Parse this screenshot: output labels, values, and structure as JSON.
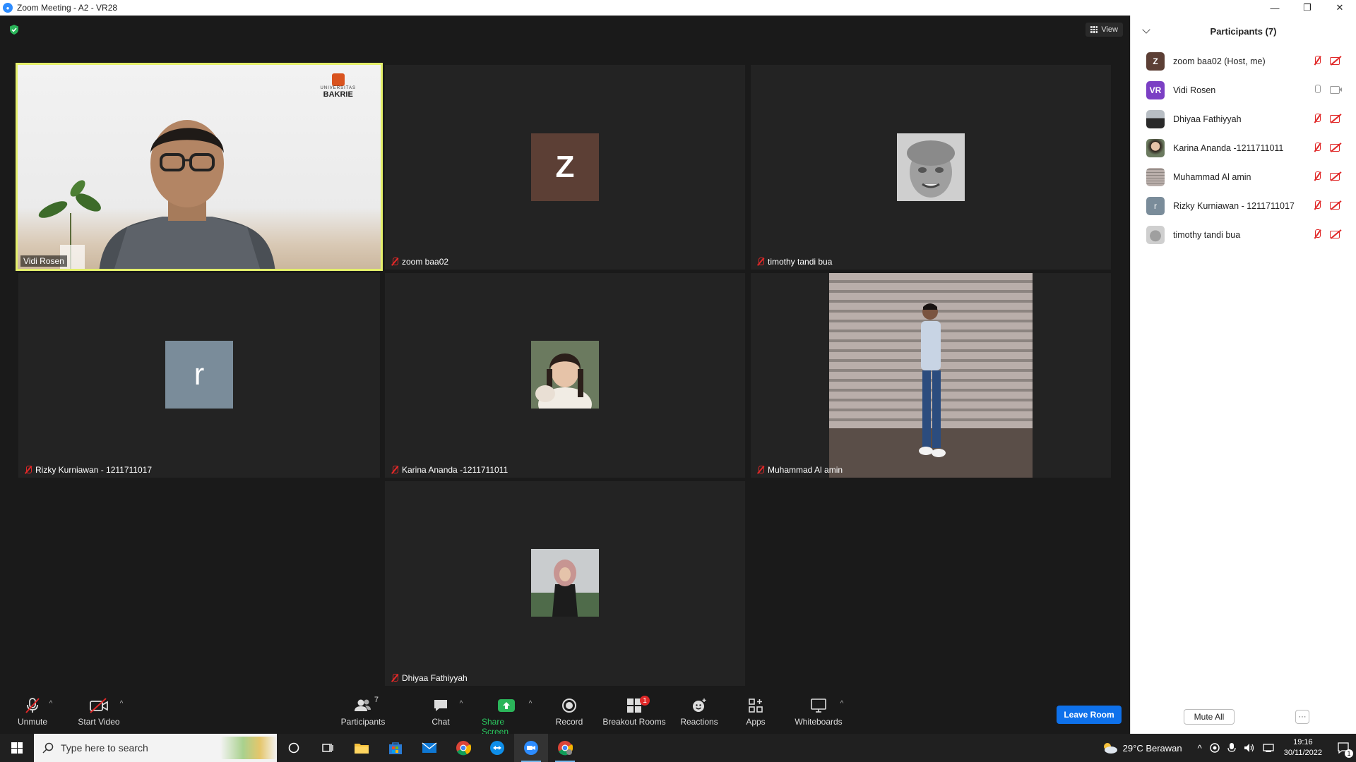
{
  "window": {
    "title": "Zoom Meeting - A2 - VR28",
    "minimize": "—",
    "restore": "❐",
    "close": "✕"
  },
  "meeting": {
    "view_label": "View",
    "tiles": [
      {
        "name": "Vidi Rosen",
        "muted": false,
        "active": true,
        "type": "video",
        "logo_line1": "UNIVERSITAS",
        "logo_line2": "BAKRIE"
      },
      {
        "name": "zoom baa02",
        "muted": true,
        "type": "initial",
        "initial": "Z",
        "color": "#5c3f35"
      },
      {
        "name": "timothy tandi bua",
        "muted": true,
        "type": "photo"
      },
      {
        "name": "Rizky Kurniawan - 1211711017",
        "muted": true,
        "type": "initial",
        "initial": "r",
        "color": "#7a8c9a"
      },
      {
        "name": "Karina Ananda -1211711011",
        "muted": true,
        "type": "photo"
      },
      {
        "name": "Muhammad Al amin",
        "muted": true,
        "type": "video"
      },
      {
        "name": "Dhiyaa Fathiyyah",
        "muted": true,
        "type": "photo"
      }
    ]
  },
  "toolbar": {
    "unmute": "Unmute",
    "start_video": "Start Video",
    "participants": "Participants",
    "participants_count": "7",
    "chat": "Chat",
    "share_screen": "Share Screen",
    "record": "Record",
    "breakout_rooms": "Breakout Rooms",
    "breakout_badge": "1",
    "reactions": "Reactions",
    "apps": "Apps",
    "whiteboards": "Whiteboards",
    "leave": "Leave Room"
  },
  "panel": {
    "title": "Participants (7)",
    "participants": [
      {
        "name": "zoom baa02 (Host, me)",
        "avatar": "Z",
        "color": "#5c3f35",
        "mic": "muted",
        "cam": "muted"
      },
      {
        "name": "Vidi Rosen",
        "avatar": "VR",
        "color": "#7b3fc4",
        "mic": "on",
        "cam": "on"
      },
      {
        "name": "Dhiyaa Fathiyyah",
        "avatar": "",
        "color": "#8b9aa5",
        "mic": "muted",
        "cam": "muted"
      },
      {
        "name": "Karina Ananda -1211711011",
        "avatar": "",
        "color": "#c4a99a",
        "mic": "muted",
        "cam": "muted"
      },
      {
        "name": "Muhammad Al amin",
        "avatar": "",
        "color": "#a89f98",
        "mic": "muted",
        "cam": "muted"
      },
      {
        "name": "Rizky Kurniawan - 1211711017",
        "avatar": "r",
        "color": "#7a8c9a",
        "mic": "muted",
        "cam": "muted"
      },
      {
        "name": "timothy tandi bua",
        "avatar": "",
        "color": "#9a9a9a",
        "mic": "muted",
        "cam": "muted"
      }
    ],
    "mute_all": "Mute All",
    "more": "···"
  },
  "taskbar": {
    "search_placeholder": "Type here to search",
    "weather": "29°C  Berawan",
    "time": "19:16",
    "date": "30/11/2022",
    "notification_count": "1"
  }
}
